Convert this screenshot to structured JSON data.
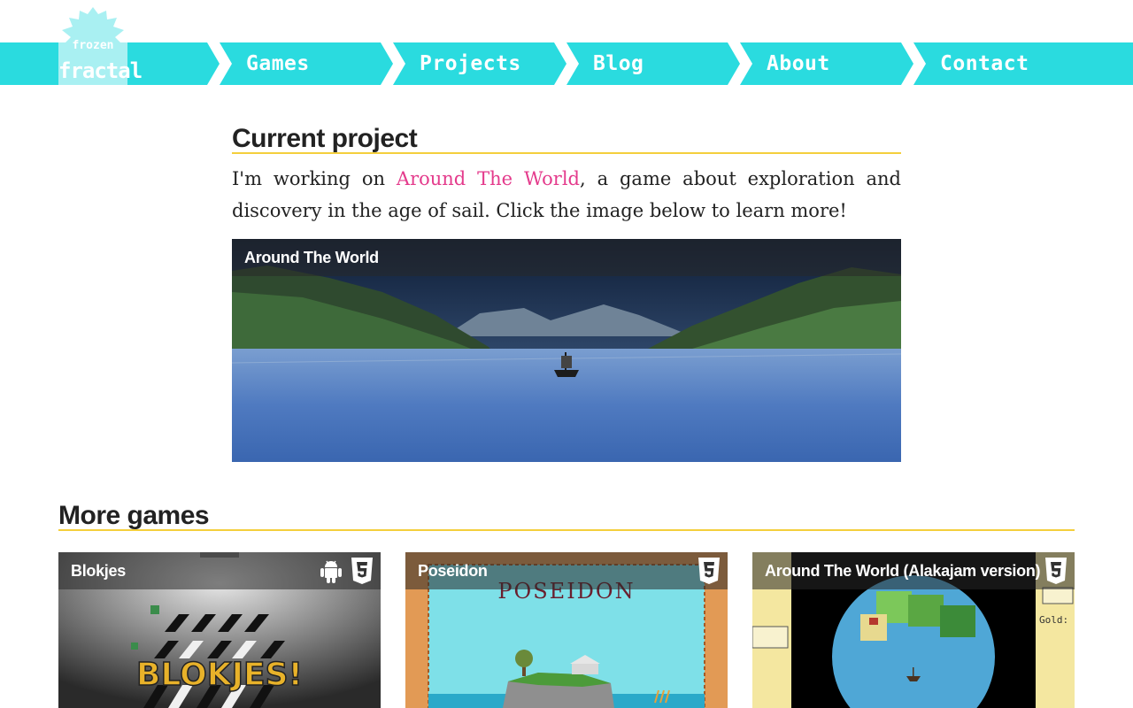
{
  "nav": {
    "logo": {
      "line1": "frozen",
      "line2": "fractal"
    },
    "items": [
      {
        "label": "Games"
      },
      {
        "label": "Projects"
      },
      {
        "label": "Blog"
      },
      {
        "label": "About"
      },
      {
        "label": "Contact"
      }
    ]
  },
  "current_project": {
    "heading": "Current project",
    "text_before": "I'm working on ",
    "link_text": "Around The World",
    "text_after": ", a game about exploration and discovery in the age of sail. Click the image below to learn more!",
    "card_title": "Around The World"
  },
  "more_games": {
    "heading": "More games",
    "cards": [
      {
        "title": "Blokjes",
        "platforms": [
          "android-icon",
          "html5-icon"
        ],
        "image_text": "BLOKJES!"
      },
      {
        "title": "Poseidon",
        "platforms": [
          "html5-icon"
        ],
        "image_text": "POSEIDON"
      },
      {
        "title": "Around The World (Alakajam version)",
        "platforms": [
          "html5-icon"
        ],
        "image_text": "Gold:"
      }
    ]
  },
  "colors": {
    "nav": "#2adbdf",
    "accent_link": "#e43b8c",
    "heading_underline": "#f4cf3c"
  }
}
